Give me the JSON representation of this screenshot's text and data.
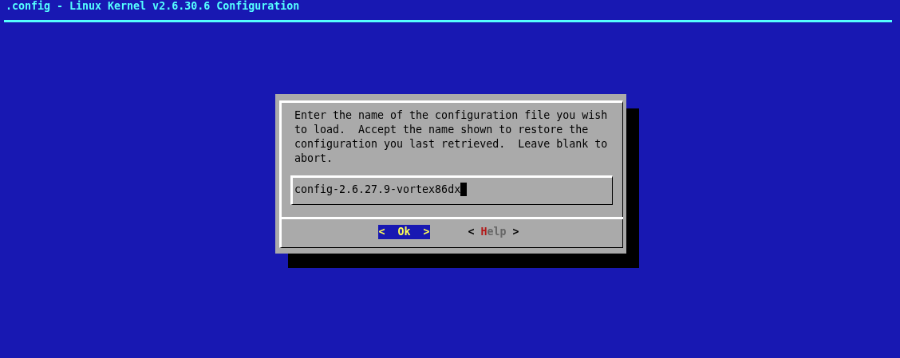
{
  "window": {
    "title": ".config - Linux Kernel v2.6.30.6 Configuration"
  },
  "dialog": {
    "message": "Enter the name of the configuration file you wish to load.  Accept the name shown to restore the configuration you last retrieved.  Leave blank to abort.",
    "input": {
      "value": "config-2.6.27.9-vortex86dx"
    },
    "buttons": [
      {
        "open": "<",
        "label": "Ok",
        "close": ">",
        "selected": true
      },
      {
        "open": "<",
        "label": "Help",
        "close": ">",
        "selected": false
      }
    ]
  }
}
